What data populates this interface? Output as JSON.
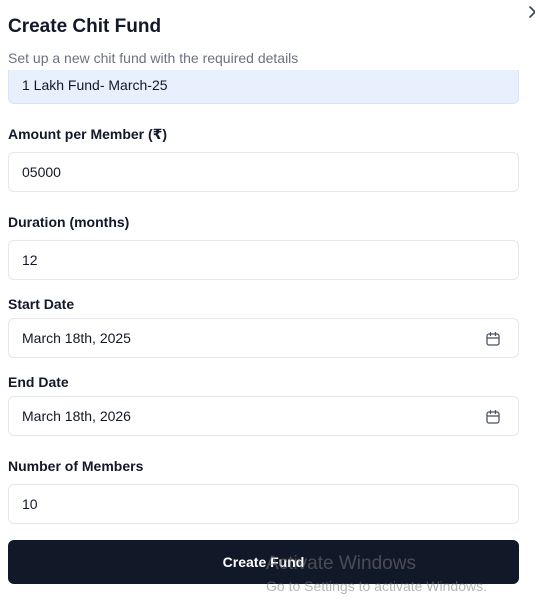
{
  "dialog": {
    "title": "Create Chit Fund",
    "subtitle": "Set up a new chit fund with the required details",
    "close_icon": "chevron-right-icon"
  },
  "form": {
    "name_value": "1 Lakh Fund- March-25",
    "amount_label": "Amount per Member (₹)",
    "amount_value": "05000",
    "duration_label": "Duration (months)",
    "duration_value": "12",
    "start_label": "Start Date",
    "start_value": "March 18th, 2025",
    "end_label": "End Date",
    "end_value": "March 18th, 2026",
    "members_label": "Number of Members",
    "members_value": "10",
    "submit_label": "Create Fund",
    "calendar_icon": "calendar-icon"
  },
  "watermark": {
    "title": "Activate Windows",
    "subtitle": "Go to Settings to activate Windows."
  },
  "colors": {
    "primary": "#111827",
    "autofill_bg": "#e8f0fe",
    "border": "#e5e7eb",
    "muted_text": "#6b7280"
  }
}
